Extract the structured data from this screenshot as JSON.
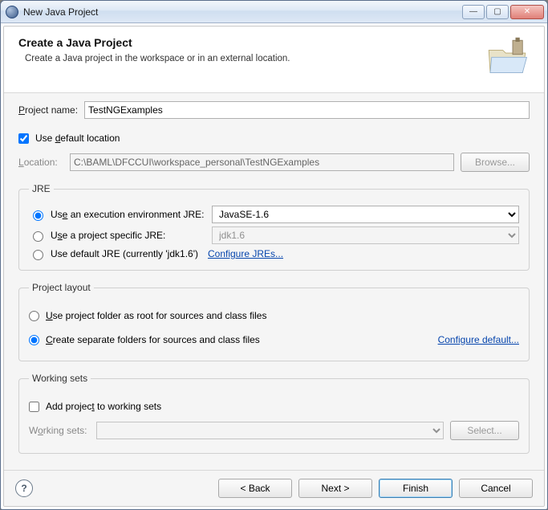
{
  "window": {
    "title": "New Java Project"
  },
  "header": {
    "title": "Create a Java Project",
    "subtitle": "Create a Java project in the workspace or in an external location."
  },
  "projectName": {
    "label": "Project name:",
    "value": "TestNGExamples"
  },
  "defaultLocation": {
    "checkboxLabel": "Use default location",
    "checked": true,
    "locationLabel": "Location:",
    "locationValue": "C:\\BAML\\DFCCUI\\workspace_personal\\TestNGExamples",
    "browseLabel": "Browse..."
  },
  "jre": {
    "legend": "JRE",
    "opt1": {
      "label": "Use an execution environment JRE:",
      "selected": true,
      "value": "JavaSE-1.6"
    },
    "opt2": {
      "label": "Use a project specific JRE:",
      "selected": false,
      "value": "jdk1.6"
    },
    "opt3": {
      "label": "Use default JRE (currently 'jdk1.6')",
      "selected": false
    },
    "configureLink": "Configure JREs..."
  },
  "projectLayout": {
    "legend": "Project layout",
    "opt1": {
      "label": "Use project folder as root for sources and class files",
      "selected": false
    },
    "opt2": {
      "label": "Create separate folders for sources and class files",
      "selected": true
    },
    "configureLink": "Configure default..."
  },
  "workingSets": {
    "legend": "Working sets",
    "addLabel": "Add project to working sets",
    "addChecked": false,
    "comboLabel": "Working sets:",
    "selectLabel": "Select..."
  },
  "footer": {
    "back": "< Back",
    "next": "Next >",
    "finish": "Finish",
    "cancel": "Cancel"
  }
}
